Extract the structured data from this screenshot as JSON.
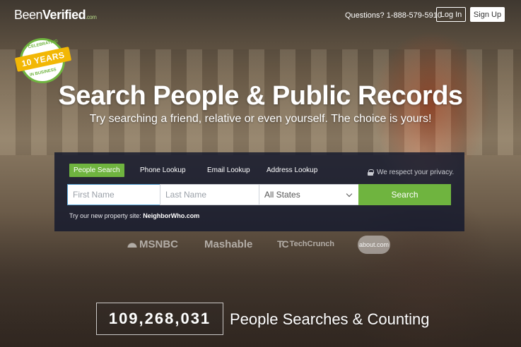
{
  "header": {
    "logo_been": "Been",
    "logo_verified": "Verified",
    "logo_dotcom": ".com",
    "phone": "Questions? 1-888-579-5910",
    "login_label": "Log In",
    "signup_label": "Sign Up"
  },
  "badge": {
    "top_text": "CELEBRATING",
    "ribbon_text": "10 YEARS",
    "bottom_text": "IN BUSINESS"
  },
  "hero": {
    "headline": "Search People & Public Records",
    "subline": "Try searching a friend, relative or even yourself. The choice is yours!"
  },
  "search": {
    "tabs": [
      {
        "label": "People Search",
        "active": true
      },
      {
        "label": "Phone Lookup",
        "active": false
      },
      {
        "label": "Email Lookup",
        "active": false
      },
      {
        "label": "Address Lookup",
        "active": false
      }
    ],
    "privacy_text": "We respect your privacy.",
    "first_name_placeholder": "First Name",
    "last_name_placeholder": "Last Name",
    "state_selected": "All States",
    "search_button": "Search",
    "property_note_prefix": "Try our new property site: ",
    "property_note_link": "NeighborWho.com"
  },
  "press": {
    "msnbc": "MSNBC",
    "mashable": "Mashable",
    "techcrunch_mark": "TC",
    "techcrunch": "TechCrunch",
    "about": "about.com"
  },
  "stats": {
    "count": "109,268,031",
    "label": "People Searches & Counting"
  },
  "colors": {
    "accent_green": "#6fb43f",
    "panel_bg": "#14192d",
    "badge_gold": "#f2b705"
  }
}
